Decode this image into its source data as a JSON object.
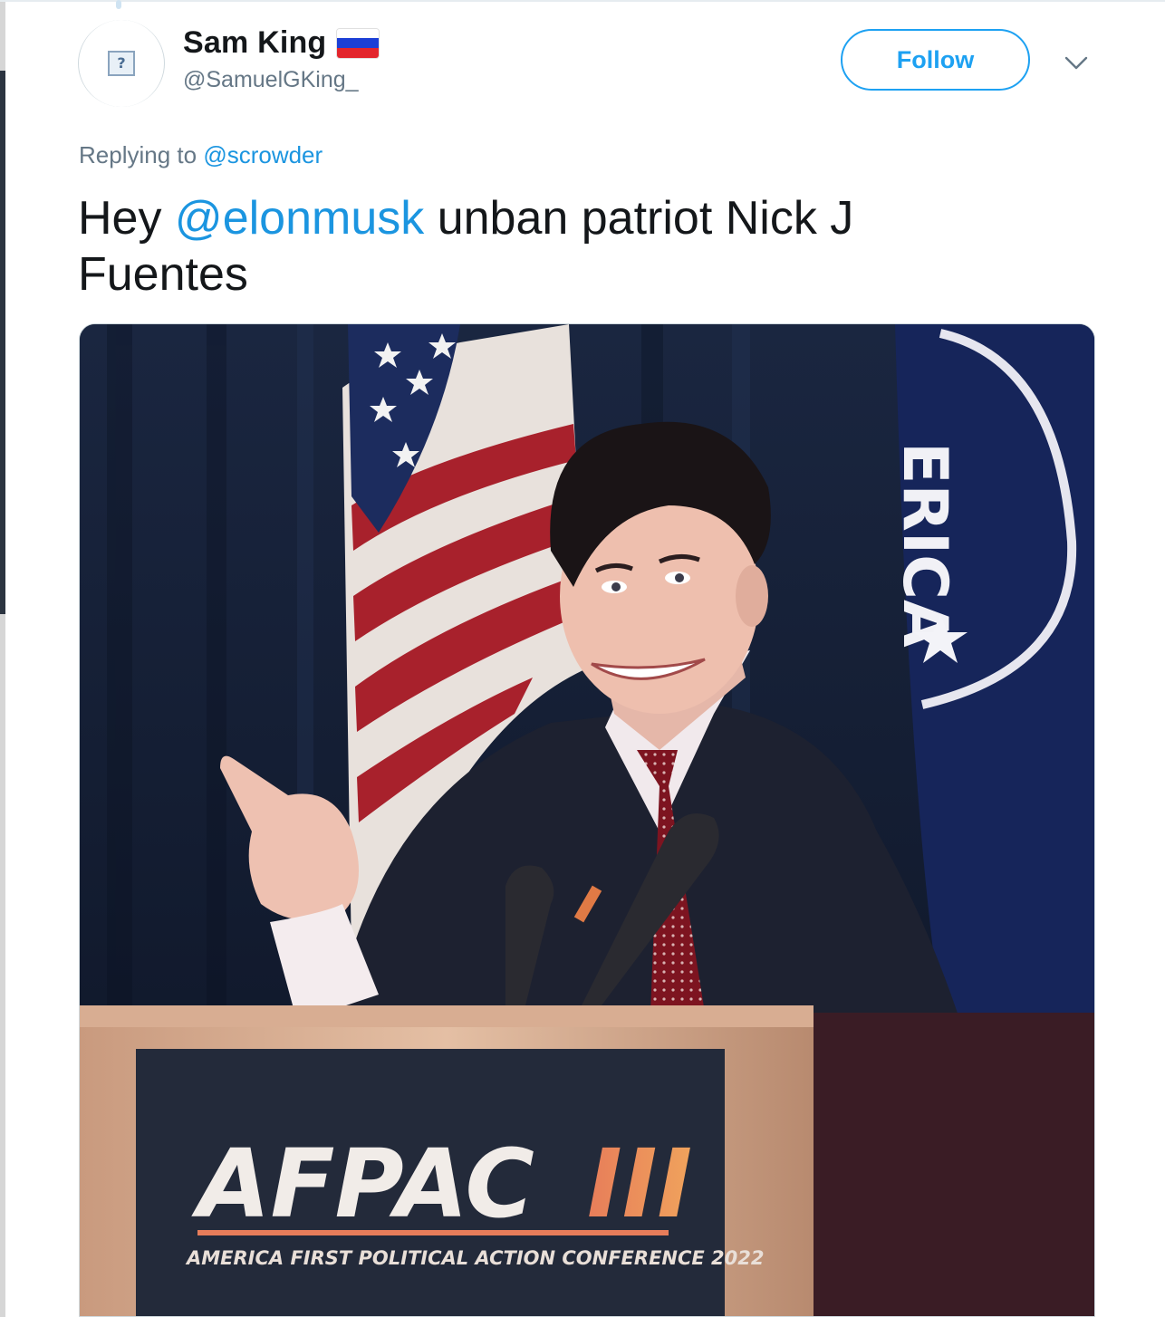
{
  "tweet": {
    "author": {
      "display_name": "Sam King",
      "handle": "@SamuelGKing_",
      "flag_icon": "russia-flag-icon",
      "flag_colors": [
        "#ffffff",
        "#1c3fd6",
        "#e3252c"
      ],
      "avatar_icon": "broken-image-icon",
      "avatar_glyph": "?"
    },
    "follow_button_label": "Follow",
    "menu_icon": "chevron-down-icon",
    "reply_prefix": "Replying to",
    "reply_target": "@scrowder",
    "text_parts": {
      "before_mention": "Hey ",
      "mention": "@elonmusk",
      "after_mention": " unban patriot Nick J Fuentes"
    },
    "media": {
      "description_icon": "photo-image",
      "background_text": "ERICA",
      "podium_logo": "AFPAC",
      "podium_roman": "III",
      "podium_caption": "AMERICA FIRST POLITICAL ACTION CONFERENCE 2022"
    }
  },
  "colors": {
    "accent": "#1da1f2",
    "link": "#1b95e0",
    "text": "#14171a",
    "secondary_text": "#657786"
  }
}
